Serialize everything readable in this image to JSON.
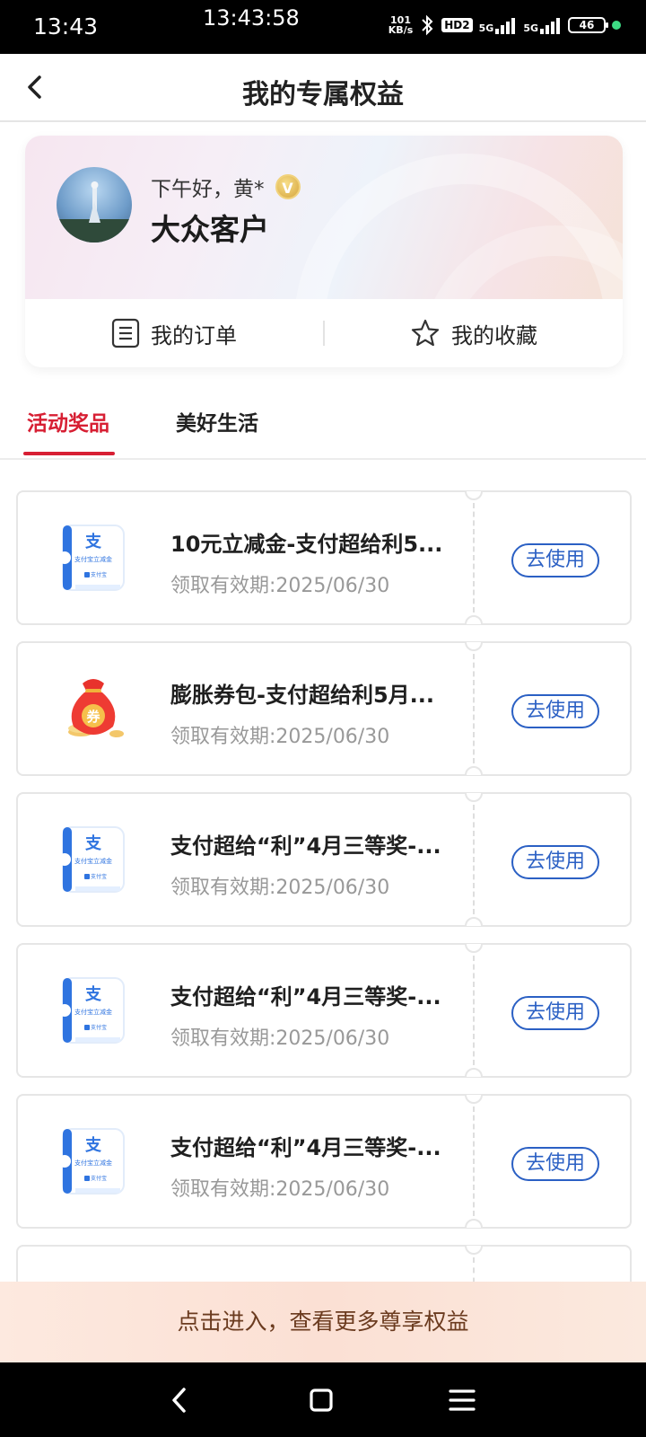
{
  "status_bar": {
    "time": "13:43",
    "center_time": "13:43:58",
    "net_speed_value": "101",
    "net_speed_unit": "KB/s",
    "hd_label": "HD2",
    "sim1": "5G",
    "sim2": "5G",
    "battery": "46"
  },
  "header": {
    "title": "我的专属权益"
  },
  "profile": {
    "greeting": "下午好，黄*",
    "badge": "V",
    "level": "大众客户",
    "links": [
      {
        "label": "我的订单",
        "icon": "order-list-icon"
      },
      {
        "label": "我的收藏",
        "icon": "star-icon"
      }
    ]
  },
  "tabs": [
    {
      "label": "活动奖品",
      "active": true
    },
    {
      "label": "美好生活",
      "active": false
    }
  ],
  "coupons": [
    {
      "icon": "alipay-coupon-icon",
      "title": "10元立减金-支付超给利5...",
      "validity": "领取有效期:2025/06/30",
      "action": "去使用"
    },
    {
      "icon": "red-bag-coupon-icon",
      "title": "膨胀券包-支付超给利5月...",
      "validity": "领取有效期:2025/06/30",
      "action": "去使用"
    },
    {
      "icon": "alipay-coupon-icon",
      "title": "支付超给“利”4月三等奖-...",
      "validity": "领取有效期:2025/06/30",
      "action": "去使用"
    },
    {
      "icon": "alipay-coupon-icon",
      "title": "支付超给“利”4月三等奖-...",
      "validity": "领取有效期:2025/06/30",
      "action": "去使用"
    },
    {
      "icon": "alipay-coupon-icon",
      "title": "支付超给“利”4月三等奖-...",
      "validity": "领取有效期:2025/06/30",
      "action": "去使用"
    }
  ],
  "icon_texts": {
    "alipay_char": "支",
    "alipay_line": "支付宝立减金",
    "alipay_brand": "支付宝",
    "bag_char": "券"
  },
  "promo": {
    "text": "点击进入，查看更多尊享权益"
  },
  "colors": {
    "accent_red": "#d71f33",
    "button_blue": "#2b60c4",
    "promo_text": "#6b3b1f"
  }
}
